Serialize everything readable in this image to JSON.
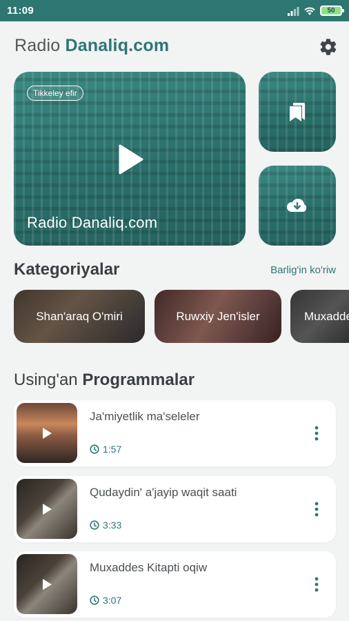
{
  "status_bar": {
    "time": "11:09",
    "battery": "50"
  },
  "header": {
    "title_prefix": "Radio ",
    "title_brand": "Danaliq.com"
  },
  "hero": {
    "badge": "Tikkeley efir",
    "label": "Radio Danaliq.com"
  },
  "categories": {
    "title": "Kategoriyalar",
    "see_all": "Barlig'in ko'riw",
    "items": [
      {
        "label": "Shan'araq O'miri"
      },
      {
        "label": "Ruwxiy Jen'isler"
      },
      {
        "label": "Muxaddes"
      }
    ]
  },
  "programs": {
    "title_prefix": "Using'an ",
    "title_bold": "Programmalar",
    "items": [
      {
        "title": "Ja'miyetlik ma'seleler",
        "duration": "1:57"
      },
      {
        "title": "Qudaydin' a'jayip waqit saati",
        "duration": "3:33"
      },
      {
        "title": "Muxaddes Kitapti oqiw",
        "duration": "3:07"
      }
    ]
  },
  "colors": {
    "accent": "#2d7672",
    "background": "#f2f3f3"
  },
  "icons": [
    "settings-gear-icon",
    "play-icon",
    "bookmarks-icon",
    "cloud-download-icon",
    "clock-icon",
    "more-vert-icon"
  ]
}
